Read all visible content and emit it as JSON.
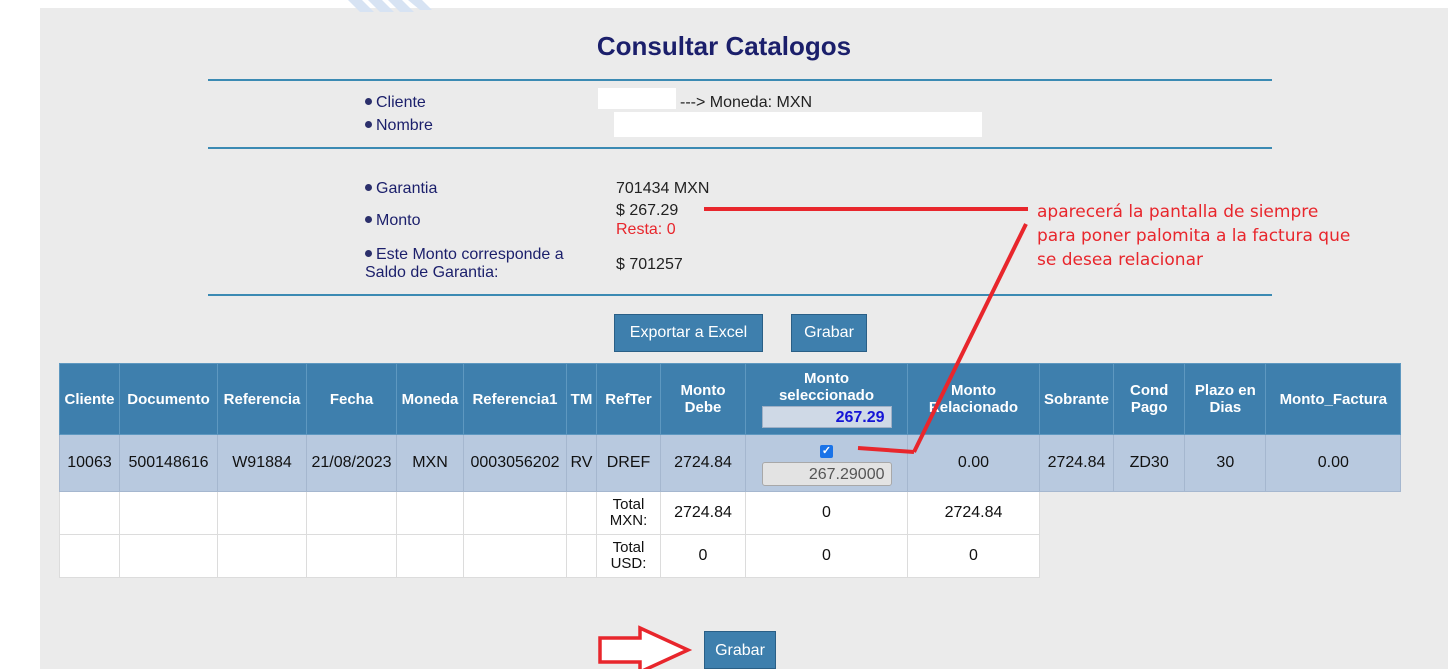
{
  "page_title": "Consultar Catalogos",
  "client_block": {
    "cliente_label": "Cliente",
    "nombre_label": "Nombre",
    "moneda_text": "---> Moneda: MXN"
  },
  "amount_block": {
    "garantia_label": "Garantia",
    "garantia_value": "701434 MXN",
    "monto_label": "Monto",
    "monto_value": "$ 267.29",
    "resta_text": "Resta: 0",
    "saldo_label_line1": "Este Monto corresponde a",
    "saldo_label_line2": "Saldo de Garantia:",
    "saldo_value": "$ 701257"
  },
  "buttons": {
    "export_label": "Exportar a Excel",
    "grabar_label": "Grabar",
    "grabar_bottom_label": "Grabar"
  },
  "table": {
    "headers": [
      "Cliente",
      "Documento",
      "Referencia",
      "Fecha",
      "Moneda",
      "Referencia1",
      "TM",
      "RefTer",
      "Monto Debe",
      "Monto seleccionado",
      "Monto Relacionado",
      "Sobrante",
      "Cond Pago",
      "Plazo en Dias",
      "Monto_Factura"
    ],
    "selected_total": "267.29",
    "row": {
      "cliente": "10063",
      "documento": "500148616",
      "referencia": "W91884",
      "fecha": "21/08/2023",
      "moneda": "MXN",
      "referencia1": "0003056202",
      "tm": "RV",
      "refter": "DREF",
      "monto_debe": "2724.84",
      "checked": "✓",
      "monto_seleccionado": "267.29000",
      "monto_relacionado": "0.00",
      "sobrante": "2724.84",
      "cond_pago": "ZD30",
      "plazo": "30",
      "monto_factura": "0.00"
    },
    "totals": [
      {
        "label": "Total MXN:",
        "debe": "2724.84",
        "seleccionado": "0",
        "relacionado": "2724.84"
      },
      {
        "label": "Total USD:",
        "debe": "0",
        "seleccionado": "0",
        "relacionado": "0"
      }
    ]
  },
  "annotation": {
    "line1": "aparecerá la pantalla de siempre",
    "line2": "para poner palomita a la factura que",
    "line3": "se desea relacionar",
    "color": "#e8262c"
  }
}
